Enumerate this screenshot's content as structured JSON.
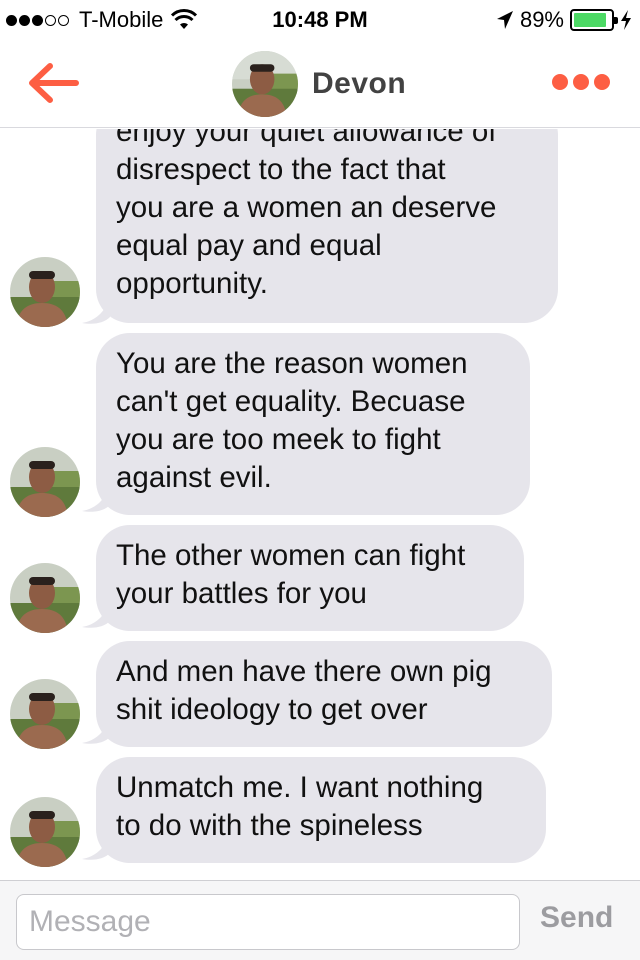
{
  "status_bar": {
    "carrier": "T-Mobile",
    "time": "10:48 PM",
    "battery": "89%",
    "battery_level": 0.89,
    "signal_bars": 3,
    "signal_total": 5
  },
  "nav": {
    "contact_name": "Devon",
    "back_icon": "back-arrow-icon",
    "more_icon": "more-dots-icon",
    "accent_color": "#fd5e43"
  },
  "messages": [
    {
      "lines": [
        "enjoy your quiet allowance of",
        "disrespect to the fact that",
        "you are a women an deserve",
        "equal pay and equal",
        "opportunity."
      ]
    },
    {
      "lines": [
        "You are the reason women",
        "can't get equality. Becuase",
        "you are too meek to fight",
        "against evil."
      ]
    },
    {
      "lines": [
        "The other women can fight",
        "your battles for you"
      ]
    },
    {
      "lines": [
        "And men have there own pig",
        "shit ideology to get over"
      ]
    },
    {
      "lines": [
        "Unmatch me. I want nothing",
        "to do with the spineless"
      ]
    }
  ],
  "composer": {
    "placeholder": "Message",
    "send_label": "Send"
  }
}
